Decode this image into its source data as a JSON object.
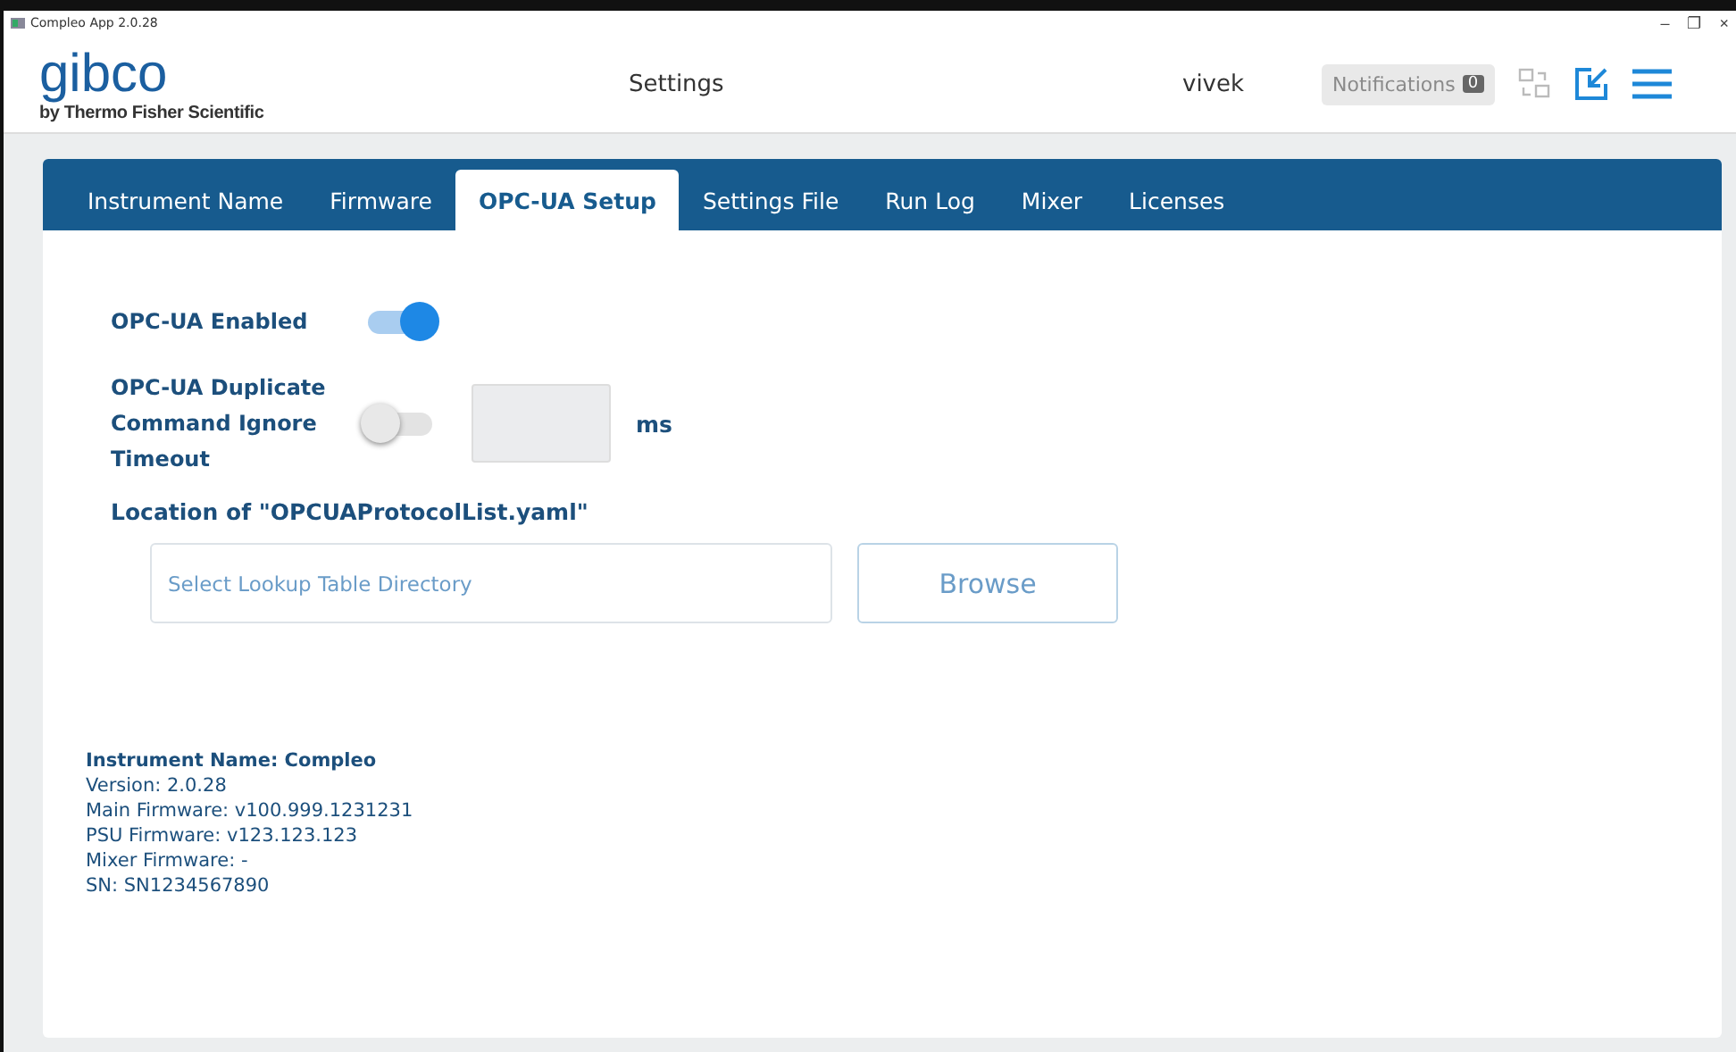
{
  "window": {
    "title": "Compleo App 2.0.28",
    "controls": [
      "–",
      "❐",
      "×"
    ]
  },
  "header": {
    "logo": "gibco",
    "logo_sub": "by Thermo Fisher Scientific",
    "page_title": "Settings",
    "user": "vivek",
    "notifications": {
      "label": "Notifications",
      "count": "0",
      "disabled": true
    }
  },
  "tabs": [
    {
      "label": "Instrument Name",
      "selected": false
    },
    {
      "label": "Firmware",
      "selected": false
    },
    {
      "label": "OPC-UA Setup",
      "selected": true
    },
    {
      "label": "Settings File",
      "selected": false
    },
    {
      "label": "Run Log",
      "selected": false
    },
    {
      "label": "Mixer",
      "selected": false
    },
    {
      "label": "Licenses",
      "selected": false
    }
  ],
  "settings": [
    {
      "label": "OPC-UA Enabled",
      "on": true
    },
    {
      "label": "OPC-UA Duplicate Command Ignore Timeout",
      "on": false,
      "unit": "ms"
    }
  ],
  "location": {
    "label": "Location of \"OPCUAProtocolList.yaml\"",
    "placeholder": "Select Lookup Table Directory",
    "button": "Browse"
  },
  "info": {
    "title": "Instrument Name: Compleo",
    "lines": [
      "Version: 2.0.28",
      "Main Firmware: v100.999.1231231",
      "PSU Firmware: v123.123.123",
      "Mixer Firmware: -",
      "SN: SN1234567890"
    ]
  }
}
